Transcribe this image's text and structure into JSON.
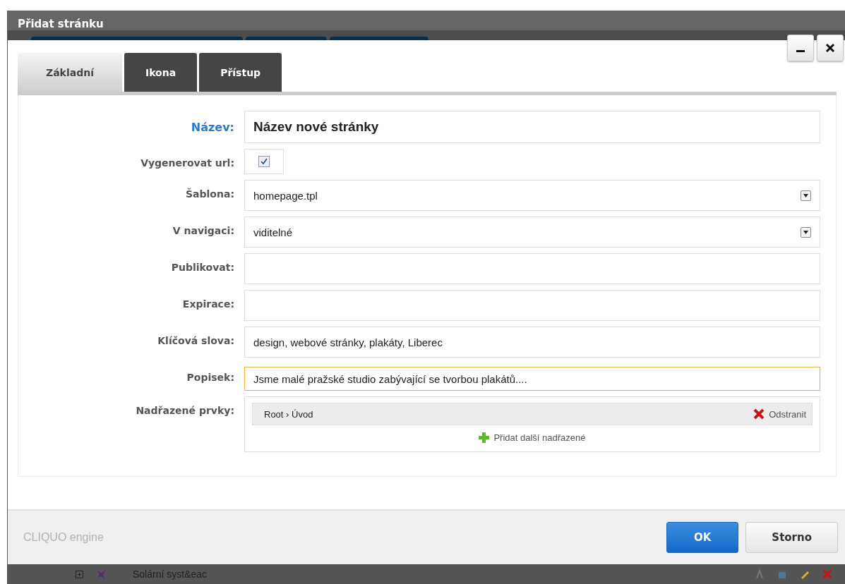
{
  "window": {
    "title": "Přidat stránku",
    "controls": [
      {
        "kind": "minimize"
      },
      {
        "kind": "close"
      }
    ]
  },
  "tabs": [
    {
      "label": "Základní",
      "selected": true
    },
    {
      "label": "Ikona",
      "selected": false
    },
    {
      "label": "Přístup",
      "selected": false
    }
  ],
  "fields": [
    {
      "kind": "text",
      "label": "Název:",
      "highlighted": true,
      "value": "Název nové stránky",
      "large": true,
      "focused": false
    },
    {
      "kind": "checkbox",
      "label": "Vygenerovat url:",
      "highlighted": false,
      "checked": true
    },
    {
      "kind": "select",
      "label": "Šablona:",
      "highlighted": false,
      "value": "homepage.tpl"
    },
    {
      "kind": "select",
      "label": "V navigaci:",
      "highlighted": false,
      "value": "viditelné"
    },
    {
      "kind": "text",
      "label": "Publikovat:",
      "highlighted": false,
      "focused": false
    },
    {
      "kind": "text",
      "label": "Expirace:",
      "highlighted": false,
      "focused": false
    },
    {
      "kind": "text",
      "label": "Klíčová slova:",
      "highlighted": false,
      "value": "design, webové stránky, plakáty, Liberec",
      "focused": false
    },
    {
      "kind": "text",
      "label": "Popisek:",
      "highlighted": false,
      "value": "Jsme malé pražské studio zabývající se tvorbou plakátů....",
      "focused": true
    },
    {
      "kind": "parents",
      "label": "Nadřazené prvky:",
      "highlighted": false,
      "items": [
        {
          "path": "Root › Úvod",
          "action": "Odstranit"
        }
      ],
      "add": "Přidat další nadřazené"
    }
  ],
  "footer": {
    "brand": "CLIQUO engine",
    "buttons": [
      {
        "label": "OK",
        "primary": true
      },
      {
        "label": "Storno",
        "primary": false
      }
    ]
  },
  "background_row": {
    "label": "Solární syst&eac"
  }
}
